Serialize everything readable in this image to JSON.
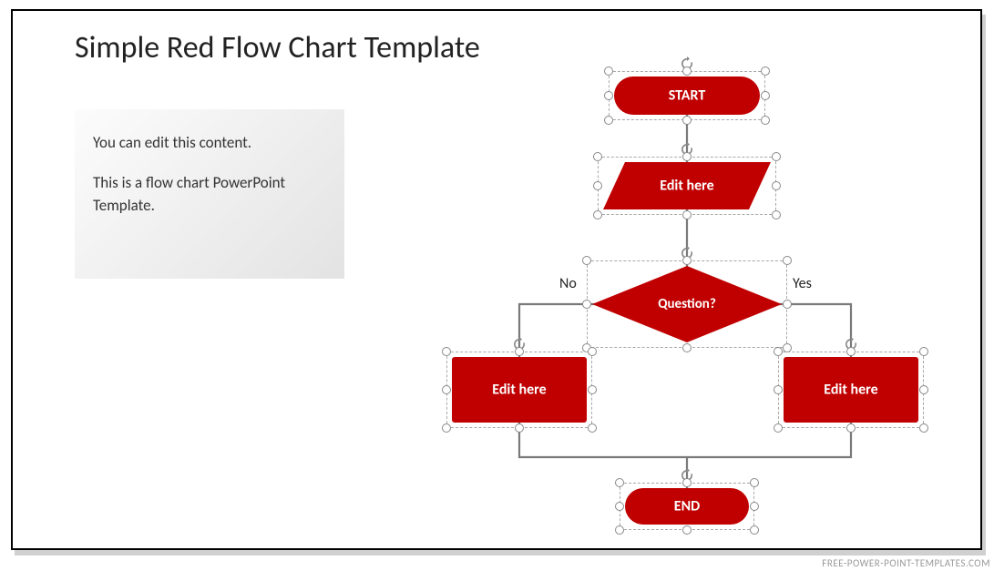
{
  "title": "Simple Red Flow Chart Template",
  "textbox": {
    "line1": "You can edit this content.",
    "line2": "This is a flow chart PowerPoint Template."
  },
  "shapes": {
    "start": "START",
    "process1": "Edit here",
    "decision": "Question?",
    "no_label": "No",
    "yes_label": "Yes",
    "process_left": "Edit here",
    "process_right": "Edit here",
    "end": "END"
  },
  "colors": {
    "accent": "#C00000"
  },
  "footer": "FREE-POWER-POINT-TEMPLATES.COM"
}
